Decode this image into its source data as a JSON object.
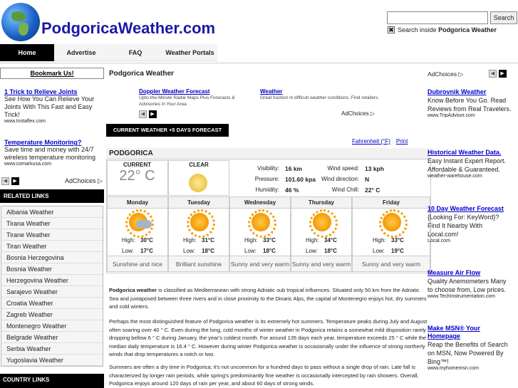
{
  "site": {
    "title": "PodgoricaWeather.com"
  },
  "search": {
    "placeholder": "",
    "button": "Search",
    "scope_prefix": "Search inside",
    "scope_name": "Podgorica Weather",
    "checked_mark": "✖"
  },
  "nav": {
    "items": [
      "Home",
      "Advertise",
      "FAQ",
      "Weather Portals"
    ]
  },
  "left": {
    "bookmark": "Bookmark Us!",
    "ads": [
      {
        "title": "1 Trick to Relieve Joints",
        "text": "See How You Can Relieve Your Joints With This Fast and Easy Trick!",
        "url": "www.Instaflex.com"
      },
      {
        "title": "Temperature Monitoring?",
        "text": "Save time and money with 24/7 wireless temperature monitoring",
        "url": "www.comarkusa.com"
      }
    ],
    "adchoices": "AdChoices",
    "related_header": "RELATED LINKS",
    "related": [
      "Albania Weather",
      "Tirana Weather",
      "Tirane Weather",
      "Tiran Weather",
      "Bosnia Herzegovina",
      "Bosnia Weather",
      "Herzegovina Weather",
      "Sarajevo Weather",
      "Croatia Weather",
      "Zagreb Weather",
      "Montenegro Weather",
      "Belgrade Weather",
      "Serbia Weather",
      "Yugoslavia Weather"
    ],
    "country_header": "COUNTRY LINKS"
  },
  "main": {
    "heading": "Podgorica Weather",
    "ads": [
      {
        "title": "Doppler Weather Forecast",
        "text": "Upto-the-Minute Radar Maps Plus Forecasts & Advisories in Your Area"
      },
      {
        "title": "Weather",
        "text": "Great traction in difficult weather conditions. Find retailers."
      }
    ],
    "adchoices": "AdChoices",
    "current_button": "CURRENT WEATHER +5 DAYS FORECAST",
    "links": {
      "fahrenheit": "Fahrenheit (°F)",
      "print": "Print"
    },
    "city": "PODGORICA",
    "current": {
      "label": "CURRENT",
      "temp": "22° C",
      "condition": "CLEAR"
    },
    "stats": [
      {
        "label": "Visibility:",
        "value": "16 km",
        "label2": "Wind speed:",
        "value2": "13 kph"
      },
      {
        "label": "Pressure:",
        "value": "101.60 kpa",
        "label2": "Wind direction:",
        "value2": "N"
      },
      {
        "label": "Humidity:",
        "value": "46 %",
        "label2": "Wind Chill:",
        "value2": "22° C"
      }
    ],
    "days": [
      {
        "name": "Monday",
        "high_label": "High:",
        "high": "30°C",
        "low_label": "Low:",
        "low": "17°C",
        "desc": "Sunshine and nice",
        "icon": "partly-cloudy-icon"
      },
      {
        "name": "Tuesday",
        "high_label": "High:",
        "high": "31°C",
        "low_label": "Low:",
        "low": "18°C",
        "desc": "Brilliant sunshine",
        "icon": "sun-icon"
      },
      {
        "name": "Wednesday",
        "high_label": "High:",
        "high": "33°C",
        "low_label": "Low:",
        "low": "18°C",
        "desc": "Sunny and very warm",
        "icon": "sun-icon"
      },
      {
        "name": "Thursday",
        "high_label": "High:",
        "high": "34°C",
        "low_label": "Low:",
        "low": "18°C",
        "desc": "Sunny and very warm",
        "icon": "sun-icon"
      },
      {
        "name": "Friday",
        "high_label": "High:",
        "high": "33°C",
        "low_label": "Low:",
        "low": "19°C",
        "desc": "Sunny and very warm",
        "icon": "sun-icon"
      }
    ],
    "paragraphs": {
      "p1_bold": "Podgorica weather",
      "p1": " is classified as Mediterranean with strong Adriatic sub tropical influences. Situated only 50 km from the Adriatic Sea and juxtaposed between three rivers and in close proximity to the Dinaric Alps, the capital of Montenegro enjoys hot, dry summers and cold winters.",
      "p2": "Perhaps the most distinguished feature of Podgorica weather is its extremely hot summers. Temperature peaks during July and August often soaring over 40 ° C. Even during the long, cold months of winter weather in Podgorica retains a somewhat mild disposition rarely dropping bellow 6 ° C during January, the year's coldest month. For around 135 days each year, temperature exceeds 25 ° C while the median daily temperature is 16.4 ° C. However during winter Podgorica weather is occasionally under the influence of strong northerly winds that drop temperatures a notch or two.",
      "p3": "Summers are often a dry time in Podgorica; it's not uncommon for a hundred days to pass without a single drop of rain. Late fall is characterized by longer rain periods, while spring's predominantly fine weather is occasionally intercepted by rain showers. Overall, Podgorica enjoys around 120 days of rain per year, and about 60 days of strong winds."
    }
  },
  "right": {
    "adchoices": "AdChoices",
    "ads": [
      {
        "title": "Dubrovnik Weather",
        "text": "Know Before You Go. Read Reviews from Real Travelers.",
        "url": "www.TripAdvisor.com"
      },
      {
        "title": "Historical Weather Data.",
        "text": "Easy Instant Expert Report. Affordable & Guaranteed.",
        "url": "weather-warehouse.com"
      },
      {
        "title": "10 Day Weather Forecast",
        "text": "{Looking For: KeyWord}? Find It Nearby With Local.com!",
        "url": "Local.com"
      },
      {
        "title": "Measure Air Flow",
        "text": "Quality Anemometers Many to choose from, Low prices.",
        "url": "www.TechInstrumentation.com"
      },
      {
        "title": "Make MSN® Your Homepage",
        "text": "Reap the Benefits of Search on MSN, Now Powered By Bing™!",
        "url": "www.myhomemsn.com"
      }
    ]
  },
  "colors": {
    "brand": "#1a1aa6",
    "link": "#0000cc",
    "nav_active": "#000000"
  }
}
